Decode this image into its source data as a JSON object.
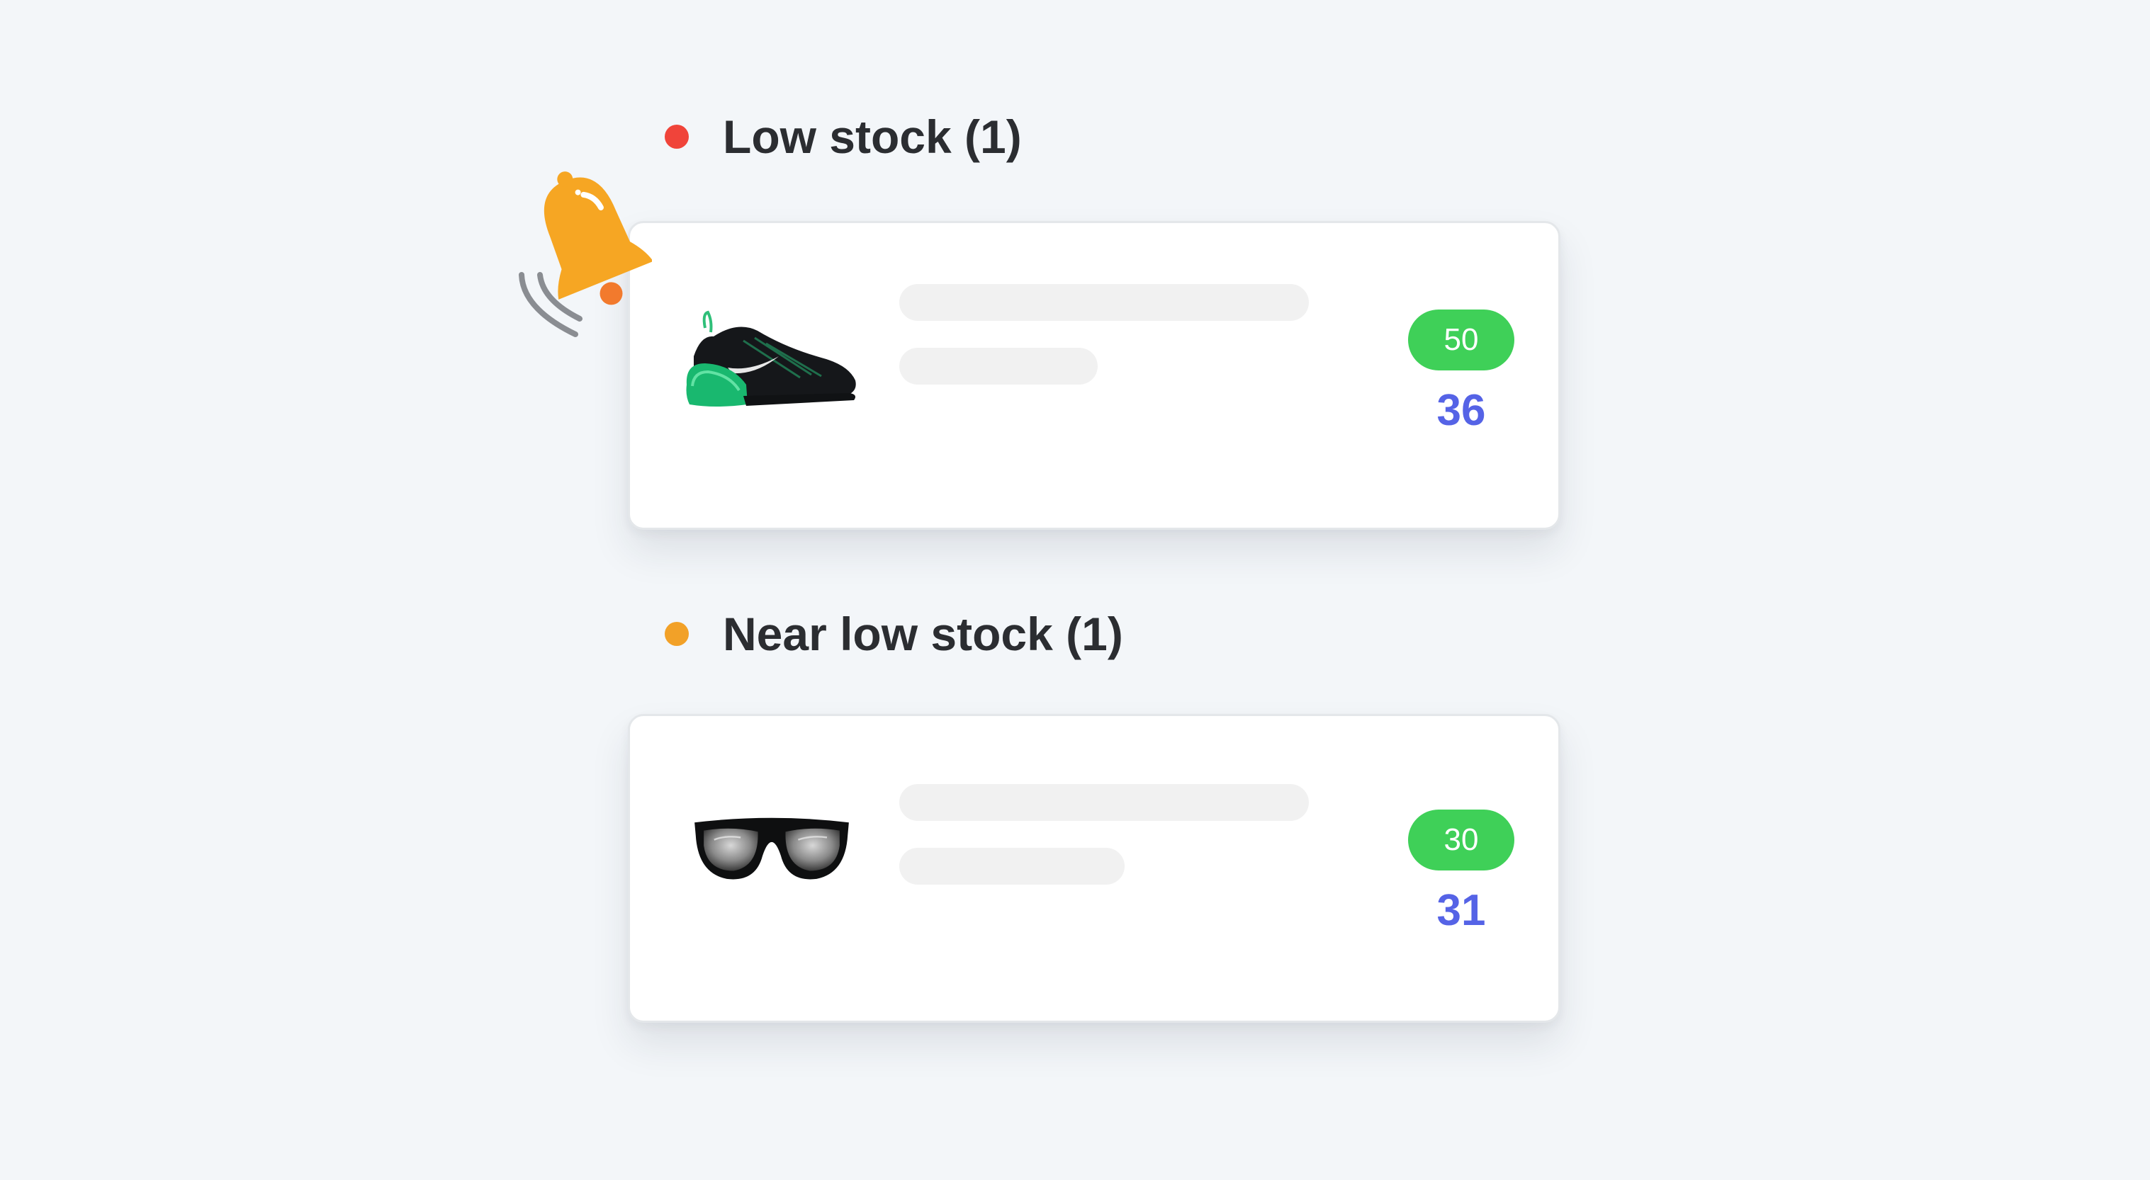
{
  "sections": [
    {
      "title": "Low stock (1)",
      "dot_color": "#f0443a",
      "item": {
        "image": "sneaker-image",
        "threshold": "50",
        "stock": "36"
      }
    },
    {
      "title": "Near low stock (1)",
      "dot_color": "#f2a128",
      "item": {
        "image": "sunglasses-image",
        "threshold": "30",
        "stock": "31"
      }
    }
  ],
  "colors": {
    "badge": "#3fd058",
    "stock_number": "#5563e6",
    "bell": "#f6a623"
  },
  "icons": [
    "bell-icon",
    "sneaker-image",
    "sunglasses-image"
  ]
}
